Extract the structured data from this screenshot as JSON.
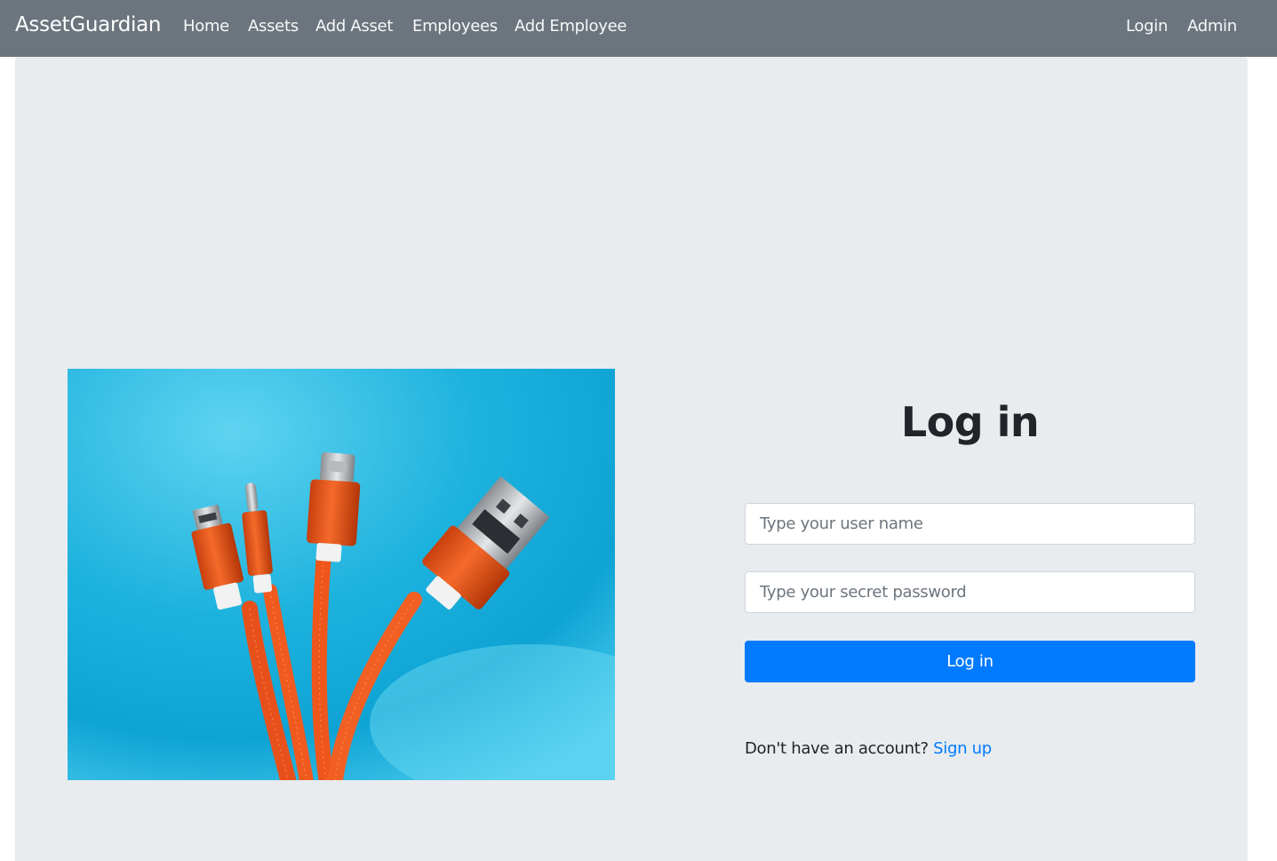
{
  "navbar": {
    "brand": "AssetGuardian",
    "links": [
      {
        "label": "Home"
      },
      {
        "label": "Assets"
      },
      {
        "label": "Add Asset"
      },
      {
        "label": "Employees"
      },
      {
        "label": "Add Employee"
      }
    ],
    "right_links": [
      {
        "label": "Login"
      },
      {
        "label": "Admin"
      }
    ]
  },
  "hero": {
    "image_subject": "orange braided charging cables with Micro-USB, Lightning, USB-C and USB-A connectors on a blue background",
    "icon": "cables-photo"
  },
  "login": {
    "title": "Log in",
    "username_placeholder": "Type your user name",
    "username_value": "",
    "password_placeholder": "Type your secret password",
    "password_value": "",
    "submit_label": "Log in",
    "signup_prompt": "Don't have an account?",
    "signup_link": "Sign up"
  },
  "colors": {
    "navbar_bg": "#6c757d",
    "page_bg": "#e9ecef",
    "primary": "#007bff",
    "cable_orange": "#f25a1f",
    "photo_blue": "#1fb3df"
  }
}
